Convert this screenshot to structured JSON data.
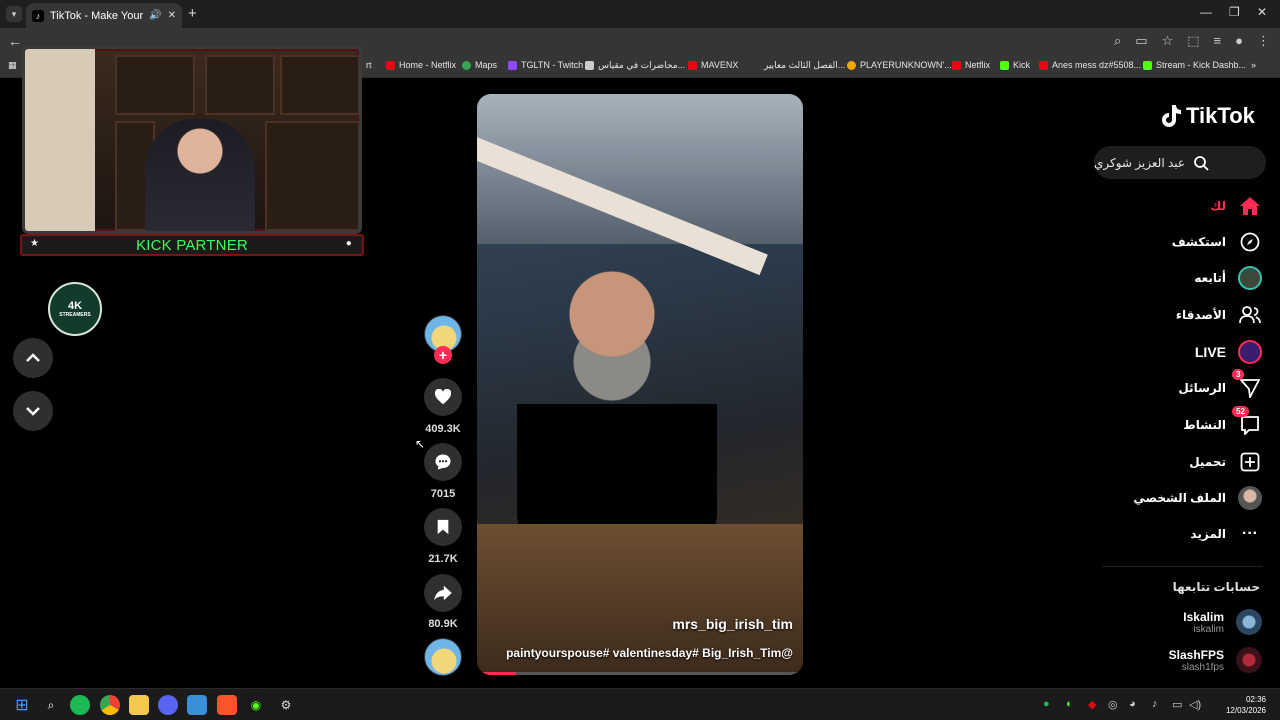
{
  "browser": {
    "tab_title": "TikTok - Make Your Day",
    "bookmarks": [
      {
        "label": "rt",
        "color": "#666666"
      },
      {
        "label": "Home - Netflix",
        "color": "#e50914"
      },
      {
        "label": "Maps",
        "color": "#34a853"
      },
      {
        "label": "TGLTN - Twitch",
        "color": "#9146ff"
      },
      {
        "label": "محاضرات في مقياس...",
        "color": "#cccccc"
      },
      {
        "label": "MAVENX",
        "color": "#e50914"
      },
      {
        "label": "الفصل الثالث معايير...",
        "color": "#cccccc"
      },
      {
        "label": "PLAYERUNKNOWN'...",
        "color": "#f2a900"
      },
      {
        "label": "Netflix",
        "color": "#e50914"
      },
      {
        "label": "Kick",
        "color": "#53fc18"
      },
      {
        "label": "Anes mess dz#5508...",
        "color": "#e50914"
      },
      {
        "label": "Stream - Kick Dashb...",
        "color": "#53fc18"
      }
    ],
    "more_bookmarks": "»"
  },
  "overlay": {
    "banner": "KICK PARTNER",
    "logo_text": "4K",
    "logo_sub": "STREAMERS"
  },
  "video": {
    "author": "mrs_big_irish_tim",
    "caption": "paintyourspouse# valentinesday# Big_Irish_Tim@",
    "progress": 0.12
  },
  "actions": {
    "likes": "409.3K",
    "comments": "7015",
    "saves": "21.7K",
    "shares": "80.9K"
  },
  "sidebar": {
    "logo": "TikTok",
    "search_text": "عبد العزيز شوكري",
    "items": [
      {
        "label": "لك",
        "icon": "home-icon",
        "active": true
      },
      {
        "label": "استكشف",
        "icon": "compass-icon"
      },
      {
        "label": "أتابعه",
        "icon": "following-avatar-icon"
      },
      {
        "label": "الأصدقاء",
        "icon": "friends-icon"
      },
      {
        "label": "LIVE",
        "icon": "live-icon"
      },
      {
        "label": "الرسائل",
        "icon": "messages-icon",
        "badge": "3"
      },
      {
        "label": "النشاط",
        "icon": "activity-icon",
        "badge": "52"
      },
      {
        "label": "تحميل",
        "icon": "upload-icon"
      },
      {
        "label": "الملف الشخصي",
        "icon": "profile-icon"
      },
      {
        "label": "المزيد",
        "icon": "more-icon"
      }
    ],
    "following_title": "حسابات تتابعها",
    "following": [
      {
        "name": "Iskalim",
        "handle": "iskalim"
      },
      {
        "name": "SlashFPS",
        "handle": "slash1fps"
      }
    ]
  },
  "taskbar": {
    "time": "02:36",
    "date": "12/03/2026"
  },
  "colors": {
    "accent": "#fe2c55",
    "kick_green": "#39ff5a"
  }
}
